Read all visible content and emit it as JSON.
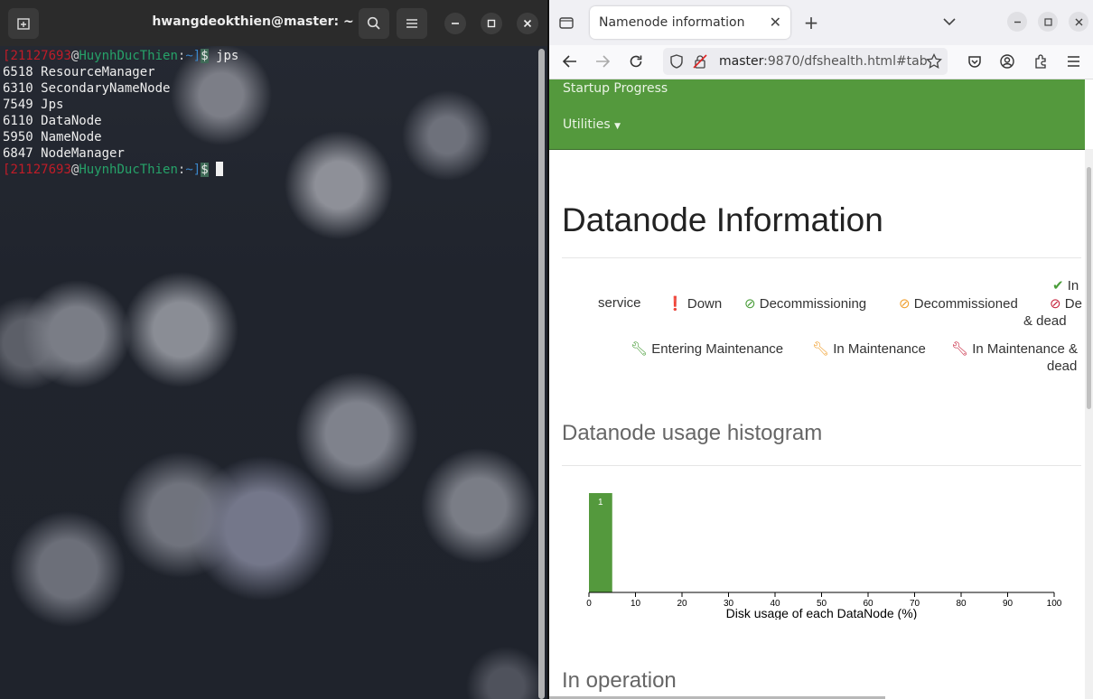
{
  "terminal": {
    "title": "hwangdeokthien@master: ~",
    "prompt": {
      "user": "21127693",
      "host": "HuynhDucThien",
      "path": "~",
      "symbol": "$"
    },
    "command": "jps",
    "lines": [
      "6518 ResourceManager",
      "6310 SecondaryNameNode",
      "7549 Jps",
      "6110 DataNode",
      "5950 NameNode",
      "6847 NodeManager"
    ],
    "icons": {
      "new_tab": "new-tab-icon",
      "search": "search-icon",
      "menu": "hamburger-menu-icon"
    }
  },
  "browser": {
    "tab_title": "Namenode information",
    "url_host": "master",
    "url_rest": ":9870/dfshealth.html#tab",
    "nav": {
      "startup_progress": "Startup Progress",
      "utilities": "Utilities"
    },
    "page": {
      "heading": "Datanode Information",
      "legend": {
        "in_service_1": "In",
        "in_service_2": "service",
        "down": "Down",
        "decommissioning": "Decommissioning",
        "decommissioned": "Decommissioned",
        "dec_dead_1": "De",
        "dec_dead_2": "& dead",
        "entering_maintenance": "Entering Maintenance",
        "in_maintenance": "In Maintenance",
        "in_maintenance_dead_1": "In Maintenance &",
        "in_maintenance_dead_2": "dead"
      },
      "histogram_title": "Datanode usage histogram",
      "in_operation": "In operation"
    },
    "colors": {
      "navbar_green": "#54993d",
      "in_service": "#4a9d3a",
      "down": "#c7253e",
      "decommissioned": "#f0a030"
    }
  },
  "chart_data": {
    "type": "bar",
    "title": "",
    "xlabel": "Disk usage of each DataNode (%)",
    "ylabel": "",
    "xlim": [
      0,
      100
    ],
    "xticks": [
      0,
      10,
      20,
      30,
      40,
      50,
      60,
      70,
      80,
      90,
      100
    ],
    "bins": [
      {
        "start": 0,
        "end": 5,
        "count": 1
      }
    ],
    "bar_color": "#54993d",
    "grid": false
  }
}
